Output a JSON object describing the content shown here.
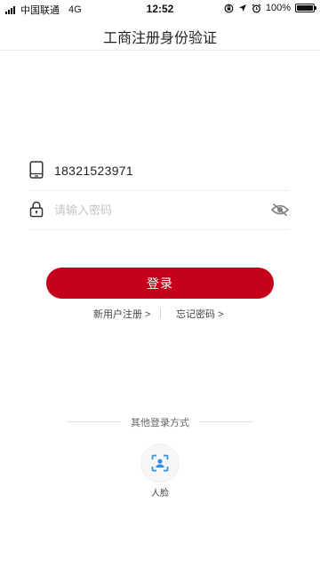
{
  "status": {
    "carrier": "中国联通",
    "network": "4G",
    "time": "12:52",
    "battery": "100%",
    "battery_level": 1.0
  },
  "header": {
    "title": "工商注册身份验证"
  },
  "login": {
    "phone_value": "18321523971",
    "password_placeholder": "请输入密码",
    "submit_label": "登录",
    "register_link": "新用户注册 >",
    "forgot_link": "忘记密码 >"
  },
  "other_methods": {
    "label": "其他登录方式",
    "face_label": "人脸"
  },
  "colors": {
    "accent": "#c4001a",
    "face_icon": "#2e8ee8"
  }
}
